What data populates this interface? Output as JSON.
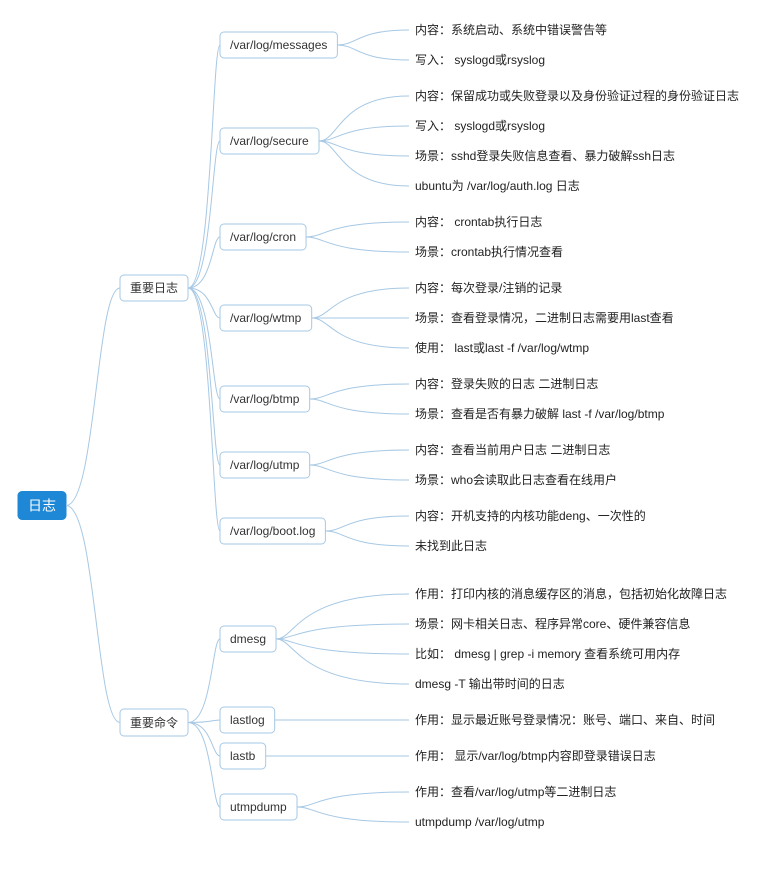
{
  "root": {
    "label": "日志"
  },
  "branches": [
    {
      "label": "重要日志",
      "children": [
        {
          "label": "/var/log/messages",
          "leaves": [
            "内容：系统启动、系统中错误警告等",
            "写入： syslogd或rsyslog"
          ]
        },
        {
          "label": "/var/log/secure",
          "leaves": [
            "内容：保留成功或失败登录以及身份验证过程的身份验证日志",
            "写入： syslogd或rsyslog",
            "场景：sshd登录失败信息查看、暴力破解ssh日志",
            "ubuntu为 /var/log/auth.log 日志"
          ]
        },
        {
          "label": "/var/log/cron",
          "leaves": [
            "内容： crontab执行日志",
            "场景：crontab执行情况查看"
          ]
        },
        {
          "label": "/var/log/wtmp",
          "leaves": [
            "内容：每次登录/注销的记录",
            "场景：查看登录情况，二进制日志需要用last查看",
            "使用： last或last -f /var/log/wtmp"
          ]
        },
        {
          "label": "/var/log/btmp",
          "leaves": [
            "内容：登录失败的日志 二进制日志",
            "场景：查看是否有暴力破解 last -f /var/log/btmp"
          ]
        },
        {
          "label": "/var/log/utmp",
          "leaves": [
            "内容：查看当前用户日志 二进制日志",
            "场景：who会读取此日志查看在线用户"
          ]
        },
        {
          "label": "/var/log/boot.log",
          "leaves": [
            "内容：开机支持的内核功能deng、一次性的",
            "未找到此日志"
          ]
        }
      ]
    },
    {
      "label": "重要命令",
      "children": [
        {
          "label": "dmesg",
          "leaves": [
            "作用：打印内核的消息缓存区的消息，包括初始化故障日志",
            "场景：网卡相关日志、程序异常core、硬件兼容信息",
            "比如： dmesg | grep -i memory 查看系统可用内存",
            "dmesg -T 输出带时间的日志"
          ]
        },
        {
          "label": "lastlog",
          "leaves": [
            "作用：显示最近账号登录情况：账号、端口、来自、时间"
          ]
        },
        {
          "label": "lastb",
          "leaves": [
            "作用： 显示/var/log/btmp内容即登录错误日志"
          ]
        },
        {
          "label": "utmpdump",
          "leaves": [
            "作用：查看/var/log/utmp等二进制日志",
            "utmpdump /var/log/utmp"
          ]
        }
      ]
    }
  ]
}
